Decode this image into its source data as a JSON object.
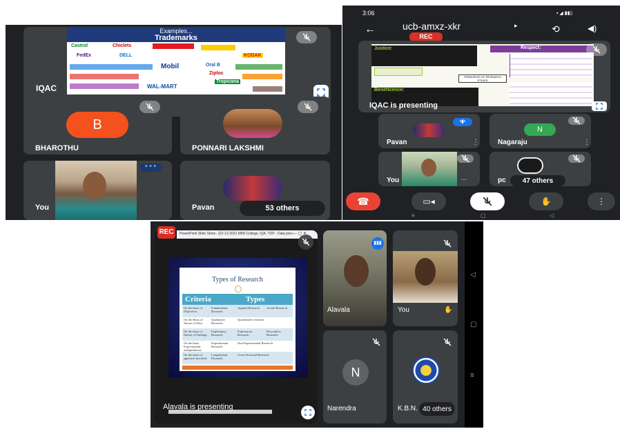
{
  "top_left": {
    "slide": {
      "title": "Examples...",
      "subtitle": "Trademarks",
      "brands": [
        "Castrol",
        "Chiclets",
        "FedEx",
        "DELL",
        "Mobil",
        "Oral B",
        "WAL-MART",
        "Tropicana",
        "Ziploc",
        "KODAK"
      ]
    },
    "presenter_label": "IQAC",
    "tiles": [
      {
        "initial": "B",
        "name": "BHAROTHU",
        "avatar_color": "#f4511e"
      },
      {
        "name": "PONNARI LAKSHMI"
      },
      {
        "name": "You"
      },
      {
        "name": "Pavan",
        "others": "53 others"
      }
    ]
  },
  "top_right": {
    "status": {
      "time": "3:06"
    },
    "meeting_code": "ucb-amxz-xkr",
    "rec_badge": "REC",
    "presenting": "IQAC is presenting",
    "slide": {
      "heading_left": "Justice:",
      "heading_right": "Respect:",
      "center": "PRINCIPLES OF RESEARCH ETHICS",
      "bottom": "Beneficence:"
    },
    "tiles": [
      {
        "name": "Pavan"
      },
      {
        "initial": "N",
        "name": "Nagaraju",
        "avatar_color": "#34a853"
      },
      {
        "name": "You"
      },
      {
        "name": "pc",
        "others": "47 others"
      }
    ]
  },
  "bottom": {
    "rec_badge": "REC",
    "window_title": "PowerPoint Slide Show - [22-12-2021 KBN College, IQA, TOP - Data presentation & interpretation (C...",
    "presenting": "Alavala is presenting",
    "slide": {
      "title": "Types of Research",
      "header": [
        "Criteria",
        "Types"
      ],
      "rows": [
        [
          "On the basis of Objectives",
          "Fundamental Research",
          "Applied Research",
          "Action Research"
        ],
        [
          "On the Basis of Nature of Data",
          "Qualitative Research",
          "Quantitative research",
          ""
        ],
        [
          "On the basis of Nature of Findings",
          "Explanatory Research",
          "Exploratory Research",
          "Descriptive Research"
        ],
        [
          "On the basis Experimental manipulations",
          "Experimental Research",
          "Non-Experimental Research",
          ""
        ],
        [
          "On the basis of approach involved",
          "Longitudinal Research",
          "Cross Sectional Research",
          ""
        ]
      ]
    },
    "tiles": [
      {
        "name": "Alavala"
      },
      {
        "name": "You"
      },
      {
        "initial": "N",
        "name": "Narendra",
        "avatar_color": "#5f6368"
      },
      {
        "name": "K.B.N.",
        "others": "40 others"
      }
    ]
  },
  "colors": {
    "meet_dark": "#202124",
    "tile": "#3c4043",
    "rec": "#d93025",
    "end_call": "#ea4335"
  }
}
